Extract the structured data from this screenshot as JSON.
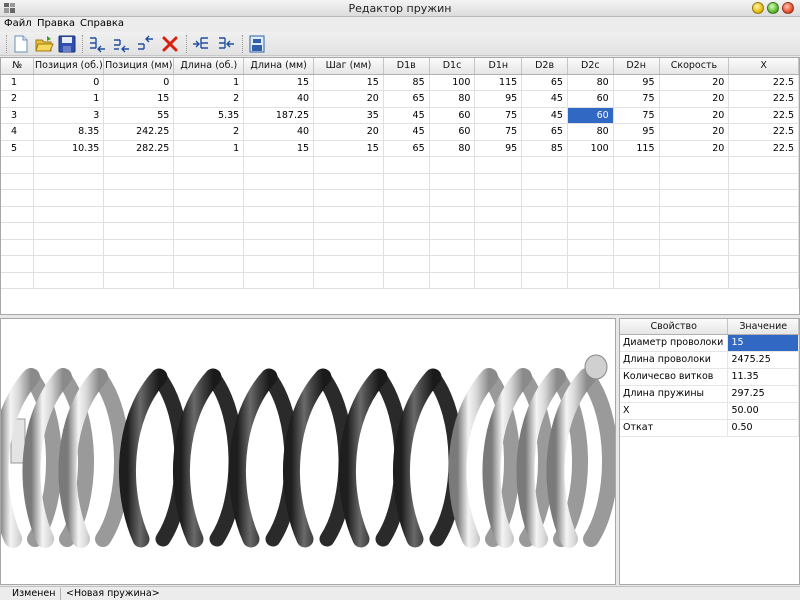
{
  "window": {
    "title": "Редактор пружин"
  },
  "menu": {
    "items": [
      "Файл",
      "Правка",
      "Справка"
    ]
  },
  "toolbar": {
    "icons": [
      "new-file-icon",
      "open-folder-icon",
      "save-icon",
      "insert-row-before-icon",
      "insert-row-icon",
      "insert-row-after-icon",
      "delete-row-icon",
      "insert-column-icon",
      "delete-column-icon",
      "export-icon"
    ]
  },
  "table": {
    "columns": [
      "№",
      "Позиция (об.)",
      "Позиция (мм)",
      "Длина (об.)",
      "Длина (мм)",
      "Шаг (мм)",
      "D1в",
      "D1с",
      "D1н",
      "D2в",
      "D2с",
      "D2н",
      "Скорость",
      "X"
    ],
    "rows": [
      [
        "1",
        "0",
        "0",
        "1",
        "15",
        "15",
        "85",
        "100",
        "115",
        "65",
        "80",
        "95",
        "20",
        "22.5"
      ],
      [
        "2",
        "1",
        "15",
        "2",
        "40",
        "20",
        "65",
        "80",
        "95",
        "45",
        "60",
        "75",
        "20",
        "22.5"
      ],
      [
        "3",
        "3",
        "55",
        "5.35",
        "187.25",
        "35",
        "45",
        "60",
        "75",
        "45",
        "60",
        "75",
        "20",
        "22.5"
      ],
      [
        "4",
        "8.35",
        "242.25",
        "2",
        "40",
        "20",
        "45",
        "60",
        "75",
        "65",
        "80",
        "95",
        "20",
        "22.5"
      ],
      [
        "5",
        "10.35",
        "282.25",
        "1",
        "15",
        "15",
        "65",
        "80",
        "95",
        "85",
        "100",
        "115",
        "20",
        "22.5"
      ]
    ],
    "selected_cell": {
      "row": 3,
      "column": "D2с"
    }
  },
  "properties": {
    "headers": {
      "property": "Свойство",
      "value": "Значение"
    },
    "rows": [
      {
        "name": "Диаметр проволоки",
        "value": "15"
      },
      {
        "name": "Длина проволоки",
        "value": "2475.25"
      },
      {
        "name": "Количесво витков",
        "value": "11.35"
      },
      {
        "name": "Длина пружины",
        "value": "297.25"
      },
      {
        "name": "X",
        "value": "50.00"
      },
      {
        "name": "Откат",
        "value": "0.50"
      }
    ],
    "selected_row": 1
  },
  "statusbar": {
    "state": "Изменен",
    "file": "<Новая пружина>"
  },
  "colors": {
    "selection": "#3168c4",
    "coil_light": "#d8d8d8",
    "coil_dark": "#3a3a3a"
  }
}
